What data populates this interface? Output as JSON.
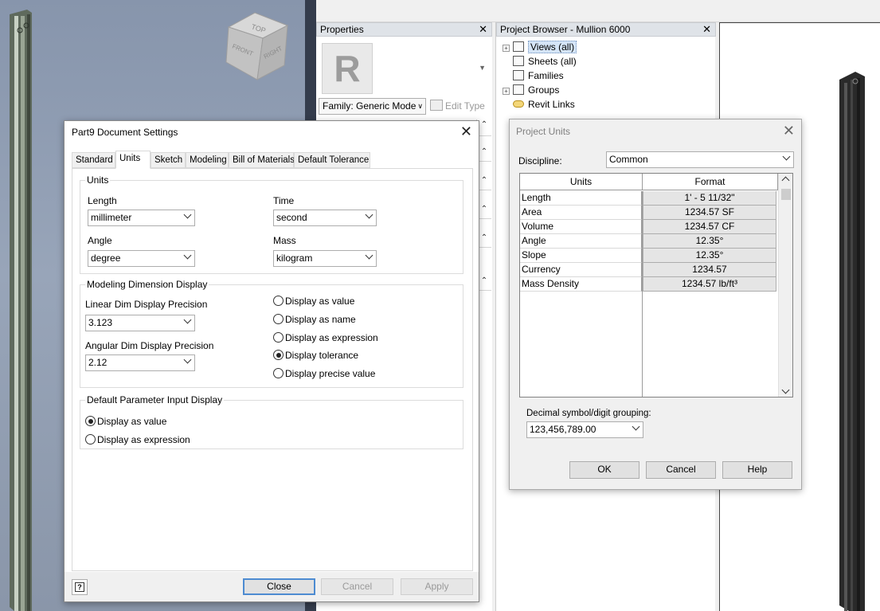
{
  "inventor": {
    "viewcube": {
      "top": "TOP",
      "front": "FRONT",
      "right": "RIGHT"
    }
  },
  "revit": {
    "properties": {
      "header": "Properties",
      "logo_letter": "R",
      "family_value": "Family: Generic Mode",
      "edit_type": "Edit Type"
    },
    "browser": {
      "header": "Project Browser - Mullion 6000",
      "items": [
        {
          "label": "Views (all)",
          "icon": "views-icon",
          "expander": "⊞"
        },
        {
          "label": "Sheets (all)",
          "icon": "sheets-icon",
          "expander": ""
        },
        {
          "label": "Families",
          "icon": "families-icon",
          "expander": ""
        },
        {
          "label": "Groups",
          "icon": "groups-icon",
          "expander": "⊞"
        },
        {
          "label": "Revit Links",
          "icon": "revit-links-icon",
          "expander": ""
        }
      ]
    }
  },
  "inv_dialog": {
    "title": "Part9 Document Settings",
    "tabs": [
      "Standard",
      "Units",
      "Sketch",
      "Modeling",
      "Bill of Materials",
      "Default Tolerance"
    ],
    "active_tab": "Units",
    "units_group": {
      "title": "Units",
      "length_label": "Length",
      "length_value": "millimeter",
      "time_label": "Time",
      "time_value": "second",
      "angle_label": "Angle",
      "angle_value": "degree",
      "mass_label": "Mass",
      "mass_value": "kilogram"
    },
    "modeling_group": {
      "title": "Modeling Dimension Display",
      "linear_label": "Linear Dim Display Precision",
      "linear_value": "3.123",
      "angular_label": "Angular Dim Display Precision",
      "angular_value": "2.12",
      "options": [
        "Display as value",
        "Display as name",
        "Display as expression",
        "Display tolerance",
        "Display precise value"
      ],
      "selected": "Display tolerance"
    },
    "param_group": {
      "title": "Default Parameter Input Display",
      "options": [
        "Display as value",
        "Display as expression"
      ],
      "selected": "Display as value"
    },
    "buttons": {
      "close": "Close",
      "cancel": "Cancel",
      "apply": "Apply",
      "help": "?"
    }
  },
  "pu_dialog": {
    "title": "Project Units",
    "discipline_label": "Discipline:",
    "discipline_value": "Common",
    "columns": [
      "Units",
      "Format"
    ],
    "rows": [
      {
        "unit": "Length",
        "format": "1' - 5 11/32\""
      },
      {
        "unit": "Area",
        "format": "1234.57 SF"
      },
      {
        "unit": "Volume",
        "format": "1234.57 CF"
      },
      {
        "unit": "Angle",
        "format": "12.35°"
      },
      {
        "unit": "Slope",
        "format": "12.35°"
      },
      {
        "unit": "Currency",
        "format": "1234.57"
      },
      {
        "unit": "Mass Density",
        "format": "1234.57 lb/ft³"
      }
    ],
    "decimal_label": "Decimal symbol/digit grouping:",
    "decimal_value": "123,456,789.00",
    "buttons": {
      "ok": "OK",
      "cancel": "Cancel",
      "help": "Help"
    }
  }
}
